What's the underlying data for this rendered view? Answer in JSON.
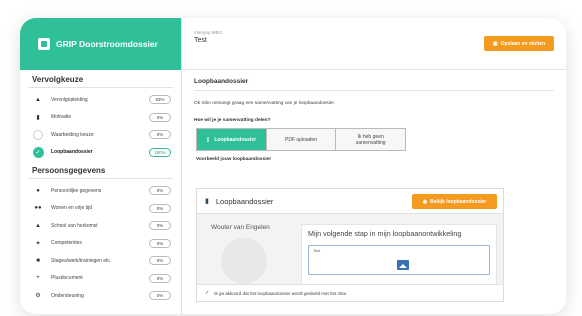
{
  "sidebar": {
    "brand": "GRIP Doorstroomdossier",
    "section1_title": "Vervolgkeuze",
    "section1_items": [
      {
        "label": "Vervolgopleiding",
        "value": "83%",
        "icon": "graduation-cap-icon"
      },
      {
        "label": "Motivatie",
        "value": "0%",
        "icon": "thumbs-up-icon"
      },
      {
        "label": "Waarbeiding keuze",
        "value": "0%",
        "icon": "empty-circle-icon"
      },
      {
        "label": "Loopbaandossier",
        "value": "100%",
        "icon": "check-circle-icon"
      }
    ],
    "section2_title": "Persoonsgegevens",
    "section2_items": [
      {
        "label": "Persoonlijke gegevens",
        "value": "0%",
        "icon": "person-icon"
      },
      {
        "label": "Wonen en vrije tijd",
        "value": "0%",
        "icon": "people-icon"
      },
      {
        "label": "School van herkomst",
        "value": "0%",
        "icon": "graduation-cap-icon"
      },
      {
        "label": "Competenties",
        "value": "0%",
        "icon": "puzzle-icon"
      },
      {
        "label": "Stages/werk/trainingen etc.",
        "value": "0%",
        "icon": "briefcase-icon"
      },
      {
        "label": "Plusdocument",
        "value": "0%",
        "icon": "plus-icon"
      },
      {
        "label": "Ondersteuning",
        "value": "0%",
        "icon": "gear-icon"
      }
    ]
  },
  "header": {
    "crumb": "Intergrip MBO",
    "title": "Test",
    "save_label": "Opslaan en sluiten"
  },
  "main": {
    "section_title": "Loopbaandossier",
    "intro": "Ok mbo ontvangt graag een samenvatting van je loopbaandossier.",
    "question": "Hoe wil je je samenvatting delen?",
    "options": [
      "Loopbaandossier",
      "PDF uploaden",
      "Ik heb geen samenvatting"
    ],
    "preview_label": "Voorbeeld jouw loopbaandossier"
  },
  "preview": {
    "title": "Loopbaandossier",
    "view_label": "Bekijk loopbaandossier",
    "name": "Wouter van Engelen",
    "heading": "Mijn volgende stap in mijn loopbaanontwikkeling",
    "box_label": "Test",
    "footer": "Ik ga akkoord dat het loopbaandossier wordt gedeeld met het mbo"
  },
  "colors": {
    "accent": "#2fc09a",
    "button": "#f39a1f"
  }
}
